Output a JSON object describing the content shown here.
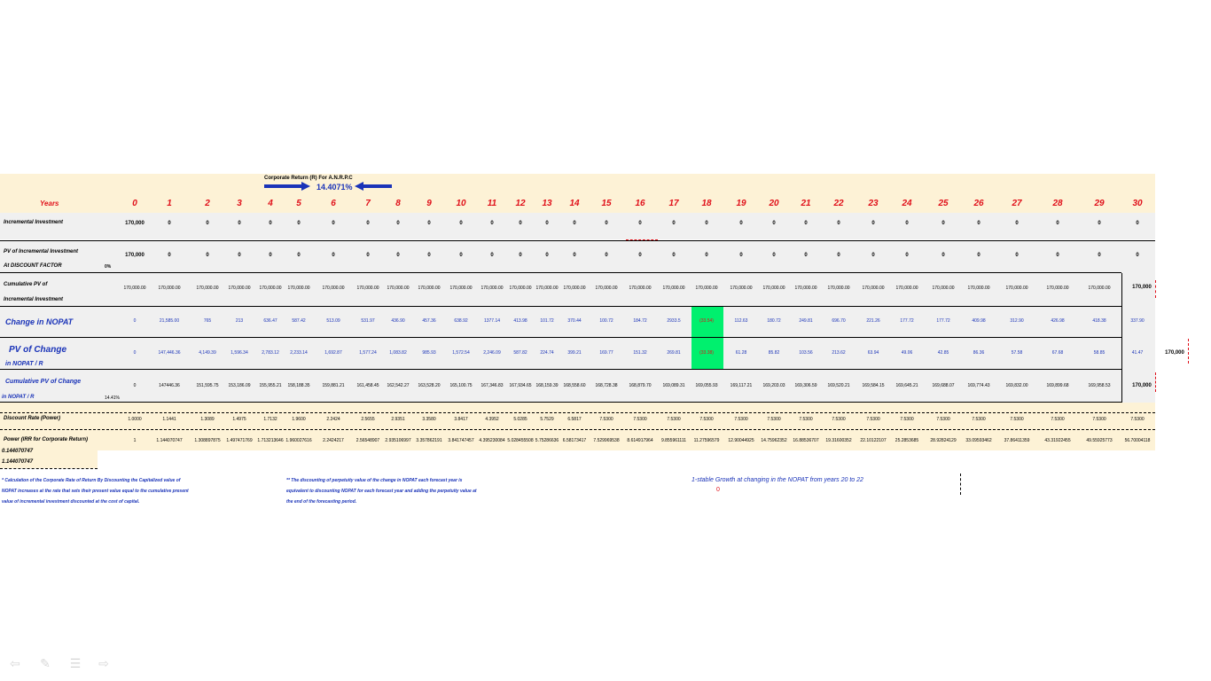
{
  "header": {
    "title": "Corporate Return (R) For A.N.R.P.C",
    "rate": "14.4071%"
  },
  "years_label": "Years",
  "years": [
    "0",
    "1",
    "2",
    "3",
    "4",
    "5",
    "6",
    "7",
    "8",
    "9",
    "10",
    "11",
    "12",
    "13",
    "14",
    "15",
    "16",
    "17",
    "18",
    "19",
    "20",
    "21",
    "22",
    "23",
    "24",
    "25",
    "26",
    "27",
    "28",
    "29",
    "30"
  ],
  "rows": {
    "incremental": {
      "label": "Incremental Investment",
      "values": [
        "170,000",
        "0",
        "0",
        "0",
        "0",
        "0",
        "0",
        "0",
        "0",
        "0",
        "0",
        "0",
        "0",
        "0",
        "0",
        "0",
        "0",
        "0",
        "0",
        "0",
        "0",
        "0",
        "0",
        "0",
        "0",
        "0",
        "0",
        "0",
        "0",
        "0",
        "0"
      ]
    },
    "pv_incremental": {
      "label": "PV of Incremental Investment",
      "sub_label": "At DISCOUNT  FACTOR",
      "sub_value": "0%",
      "values": [
        "170,000",
        "0",
        "0",
        "0",
        "0",
        "0",
        "0",
        "0",
        "0",
        "0",
        "0",
        "0",
        "0",
        "0",
        "0",
        "0",
        "0",
        "0",
        "0",
        "0",
        "0",
        "0",
        "0",
        "0",
        "0",
        "0",
        "0",
        "0",
        "0",
        "0",
        "0"
      ]
    },
    "cumulative_pv": {
      "label": "Cumulative PV of",
      "label2": "Incremental Investment",
      "total": "170,000",
      "values": [
        "170,000.00",
        "170,000.00",
        "170,000.00",
        "170,000.00",
        "170,000.00",
        "170,000.00",
        "170,000.00",
        "170,000.00",
        "170,000.00",
        "170,000.00",
        "170,000.00",
        "170,000.00",
        "170,000.00",
        "170,000.00",
        "170,000.00",
        "170,000.00",
        "170,000.00",
        "170,000.00",
        "170,000.00",
        "170,000.00",
        "170,000.00",
        "170,000.00",
        "170,000.00",
        "170,000.00",
        "170,000.00",
        "170,000.00",
        "170,000.00",
        "170,000.00",
        "170,000.00",
        "170,000.00"
      ]
    },
    "change_nopat": {
      "label": "Change in NOPAT",
      "values": [
        "0",
        "21,585.00",
        "765",
        "213",
        "636.47",
        "587.42",
        "513.09",
        "531.97",
        "436.90",
        "457.36",
        "638.92",
        "1377.14",
        "413.98",
        "101.72",
        "370.44",
        "100.72",
        "184.72",
        "2933.5",
        "(33.54)",
        "112.63",
        "180.72",
        "249.81",
        "696.70",
        "221.26",
        "177.72",
        "177.72",
        "409.98",
        "312.90",
        "426.98",
        "418.38",
        "337.90"
      ]
    },
    "pv_change": {
      "label": "PV of Change",
      "label2": "in NOPAT / R",
      "outside": "170,000",
      "values": [
        "0",
        "147,446.36",
        "4,149.39",
        "1,596.34",
        "2,783.12",
        "2,233.14",
        "1,692.87",
        "1,577.24",
        "1,083.82",
        "985.93",
        "1,572.54",
        "2,246.09",
        "587.82",
        "224.74",
        "399.21",
        "169.77",
        "151.32",
        "269.81",
        "(33.38)",
        "61.28",
        "85.82",
        "103.56",
        "213.62",
        "63.94",
        "49.06",
        "42.85",
        "86.36",
        "57.58",
        "67.68",
        "58.85",
        "41.47"
      ]
    },
    "cumulative_change": {
      "label": "Cumulative PV of Change",
      "label2": "in NOPAT / R",
      "pct": "14.41%",
      "total": "170,000",
      "values": [
        "0",
        "147446.36",
        "151,595.75",
        "153,186.09",
        "155,955.21",
        "158,188.35",
        "159,881.21",
        "161,458.45",
        "162,542.27",
        "163,528.20",
        "165,100.75",
        "167,346.83",
        "167,934.65",
        "168,159.39",
        "168,558.60",
        "168,728.38",
        "168,879.70",
        "169,089.31",
        "169,055.93",
        "169,117.21",
        "169,203.03",
        "169,306.59",
        "169,520.21",
        "169,584.15",
        "169,645.21",
        "169,688.07",
        "169,774.43",
        "169,832.00",
        "169,899.68",
        "169,958.53"
      ]
    },
    "discount_rate": {
      "label": "Discount Rate (Power)",
      "values": [
        "1.0000",
        "1.1441",
        "1.3089",
        "1.4975",
        "1.7132",
        "1.9600",
        "2.2424",
        "2.5655",
        "2.9351",
        "3.3580",
        "3.8417",
        "4.3952",
        "5.0285",
        "5.7529",
        "6.5817",
        "7.5300",
        "7.5300",
        "7.5300",
        "7.5300",
        "7.5300",
        "7.5300",
        "7.5300",
        "7.5300",
        "7.5300",
        "7.5300",
        "7.5300",
        "7.5300",
        "7.5300",
        "7.5300",
        "7.5300",
        "7.5300"
      ]
    },
    "power_irr": {
      "label": "Power (IRR for Corporate Return)",
      "values": [
        "1",
        "1.144070747",
        "1.308897875",
        "1.497471769",
        "1.713213646",
        "1.960027616",
        "2.2424217",
        "2.56548907",
        "2.935106997",
        "3.357862191",
        "3.841747457",
        "4.395230084",
        "5.028455508",
        "5.75286636",
        "6.58173417",
        "7.529969538",
        "8.614917964",
        "9.855961111",
        "11.27596579",
        "12.90044925",
        "14.75962352",
        "16.88536707",
        "19.31600352",
        "22.10122107",
        "25.2853685",
        "28.92824129",
        "33.09593462",
        "37.86411359",
        "43.31922455",
        "49.55925773",
        "56.70004118"
      ]
    }
  },
  "extra": {
    "v1": "0.144070747",
    "v2": "1.144070747"
  },
  "notes": {
    "note1": [
      "* Calculation of the Corporate Rate of Return By Discounting the Capitalized value of",
      "NOPAT increases at the rate that sets their present value equal to the cumulative present",
      "value of incremental investment discounted at the cost of capital."
    ],
    "note2": [
      "** The discounting of perpetuity value of the change in NOPAT each forecast year is",
      "equivalent to discounting NOPAT for each forecast year and adding the perpetuity value at",
      "the end of the forecasting period."
    ],
    "growth": "1-stable Growth at changing in the NOPAT from years 20  to 22",
    "zero": "0"
  },
  "colors": {
    "red": "#e0101a",
    "blue": "#1a33b8",
    "highlight": "#00f06e",
    "cream": "#fdf2d6"
  },
  "nav_icons": [
    "arrow-left-icon",
    "pen-icon",
    "menu-icon",
    "arrow-right-icon"
  ]
}
